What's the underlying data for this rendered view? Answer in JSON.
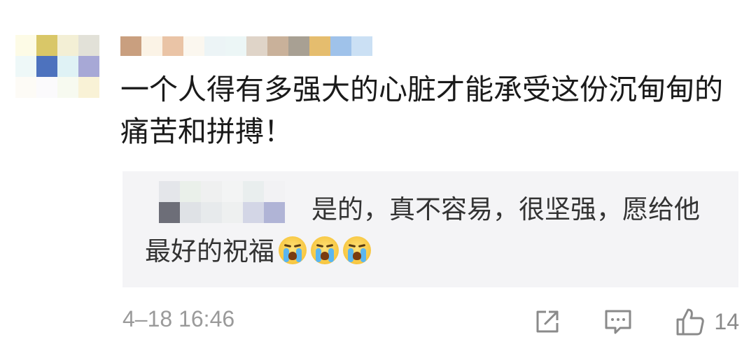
{
  "comment": {
    "text": "一个人得有多强大的心脏才能承受这份沉甸甸的痛苦和拼搏！",
    "avatar_pixels": [
      "#fdfbe6",
      "#d9c768",
      "#f3efd5",
      "#e2e1d8",
      "#eef8f8",
      "#4d72be",
      "#dff2f5",
      "#a7a8d6",
      "#fdfbf6",
      "#fbfafc",
      "#f7faf0",
      "#f9f2d6"
    ],
    "username_pixels": [
      "#c99f7f",
      "#fbf3e6",
      "#eac4a6",
      "#fbf7ef",
      "#ecf4f6",
      "#ecf6f6",
      "#dfd4c8",
      "#c9b19a",
      "#a8a093",
      "#e5bd6e",
      "#9fc2ea",
      "#cbe0f4"
    ]
  },
  "reply": {
    "text": "是的，真不容易，很坚强，愿给他最好的祝福",
    "emoji_count": 3,
    "emoji_icon": "crying-face-icon",
    "author_pixels": [
      "#f4f4f6",
      "#e4e6ea",
      "#eaf0ea",
      "#eff0f0",
      "#f3f4f4",
      "#e9eeee",
      "#f2f2f4",
      "#f4f4f6",
      "#f4f4f6",
      "#6d6e78",
      "#dfe2e6",
      "#e7eaec",
      "#eef0f0",
      "#d3d6e6",
      "#b0b4d6",
      "#f4f4f6"
    ]
  },
  "meta": {
    "timestamp": "4–18 16:46",
    "like_count": "14"
  },
  "icons": {
    "share": "share-icon",
    "comment": "comment-icon",
    "like": "thumbs-up-icon"
  },
  "colors": {
    "text_primary": "#1a1a1a",
    "text_secondary": "#9a9a9a",
    "reply_background": "#f4f4f6"
  }
}
